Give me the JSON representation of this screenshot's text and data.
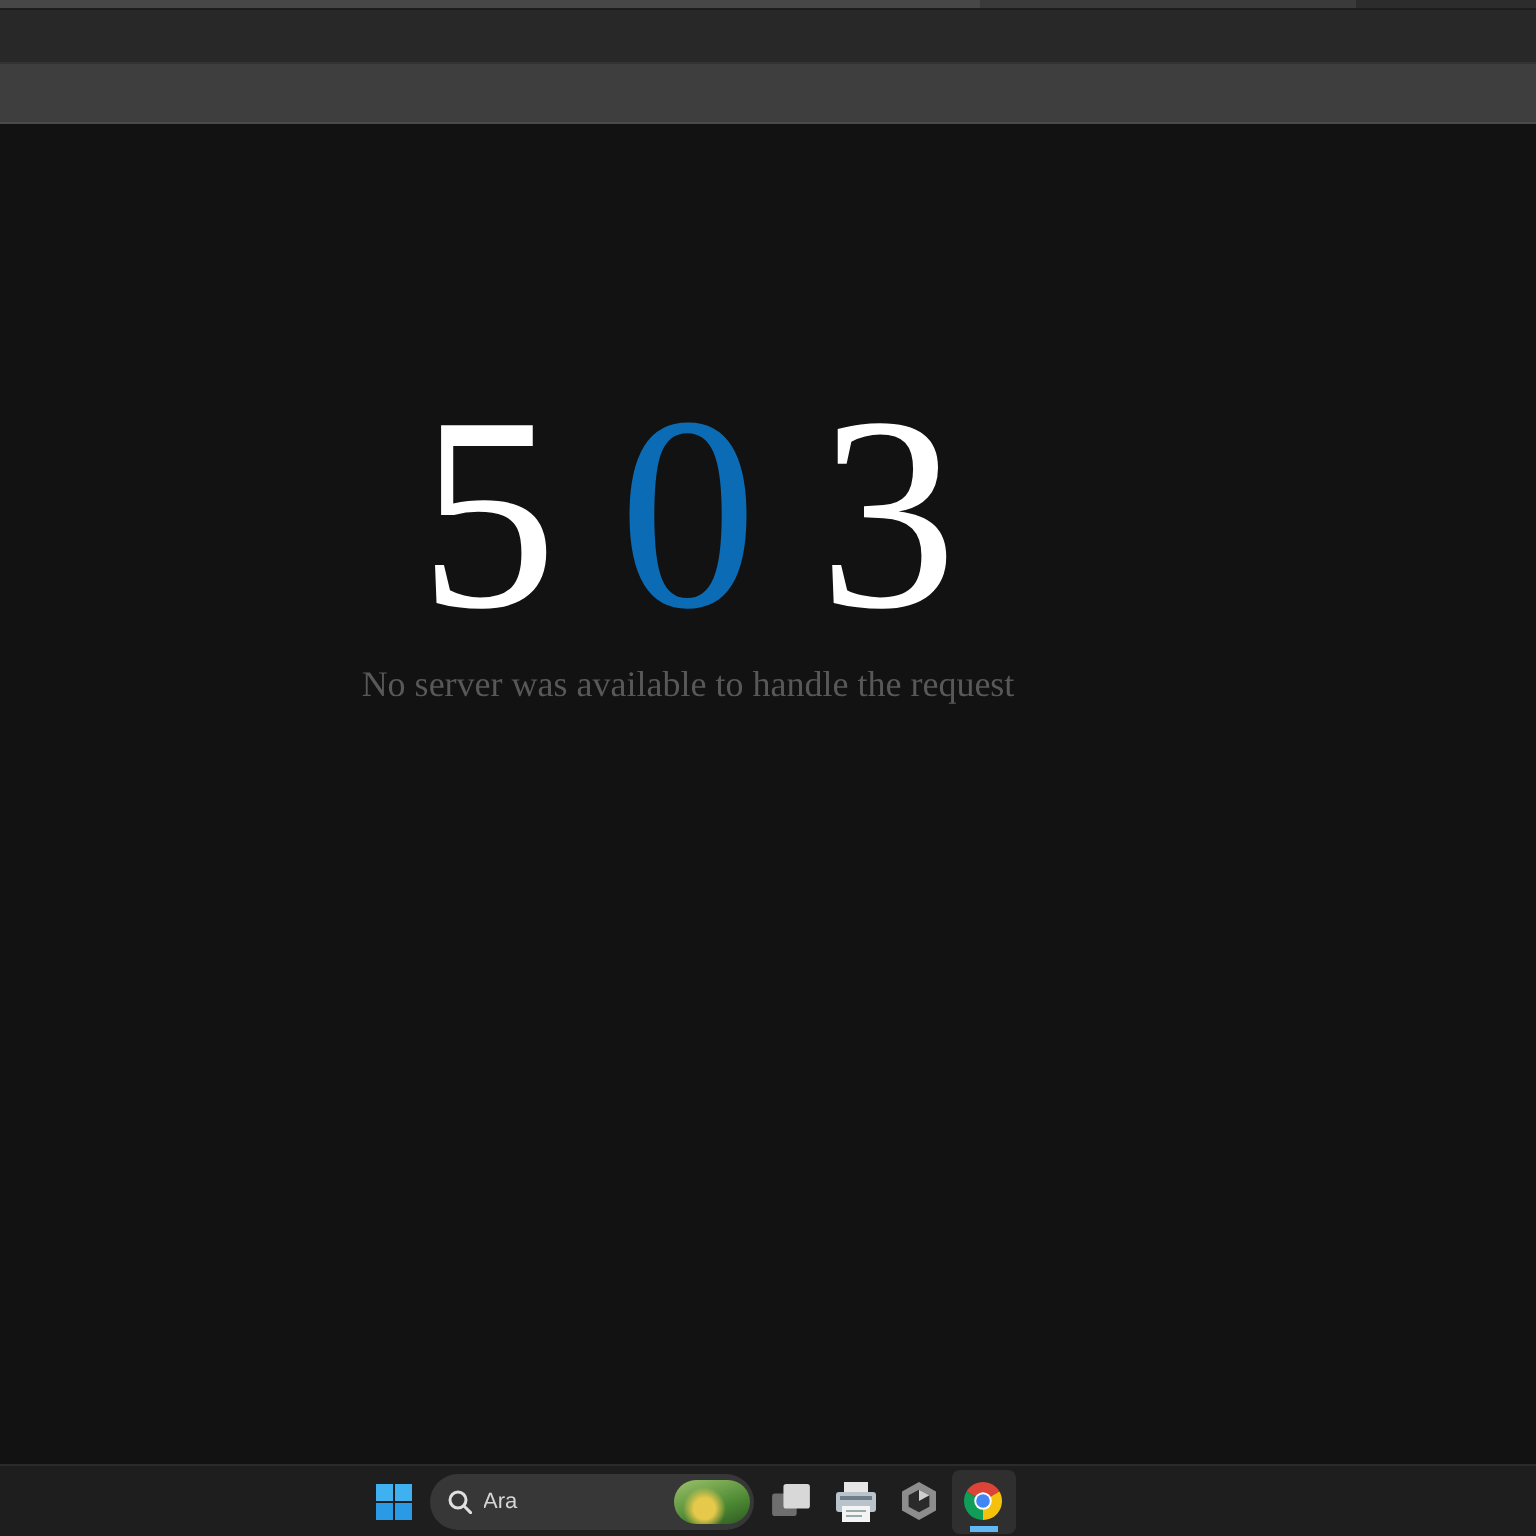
{
  "error": {
    "digits": [
      {
        "text": "5",
        "color": "#ffffff"
      },
      {
        "text": "0",
        "color": "#0b6cb5"
      },
      {
        "text": "3",
        "color": "#ffffff"
      }
    ],
    "message": "No server was available to handle the request"
  },
  "taskbar": {
    "search": {
      "placeholder": "Ara"
    },
    "apps": [
      {
        "kind": "stack",
        "selected": false
      },
      {
        "kind": "printer",
        "selected": false
      },
      {
        "kind": "hexagon",
        "selected": false
      },
      {
        "kind": "browser",
        "selected": true
      }
    ]
  }
}
